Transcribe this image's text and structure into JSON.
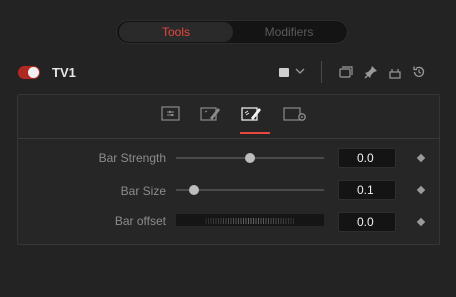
{
  "tabs": {
    "tools": "Tools",
    "modifiers": "Modifiers"
  },
  "node": {
    "name": "TV1",
    "enabled": true
  },
  "params": [
    {
      "label": "Bar Strength",
      "value": "0.0",
      "slider_fraction": 0.5
    },
    {
      "label": "Bar Size",
      "value": "0.1",
      "slider_fraction": 0.12
    },
    {
      "label": "Bar offset",
      "value": "0.0",
      "control": "thumbwheel"
    }
  ],
  "colors": {
    "accent": "#e8473c",
    "background": "#232323",
    "value_box": "#141414"
  },
  "icons": [
    "controls-icon",
    "edit-icon",
    "edit-active-icon",
    "settings-icon",
    "versions-icon",
    "pin-icon",
    "lock-icon",
    "reset-icon"
  ]
}
